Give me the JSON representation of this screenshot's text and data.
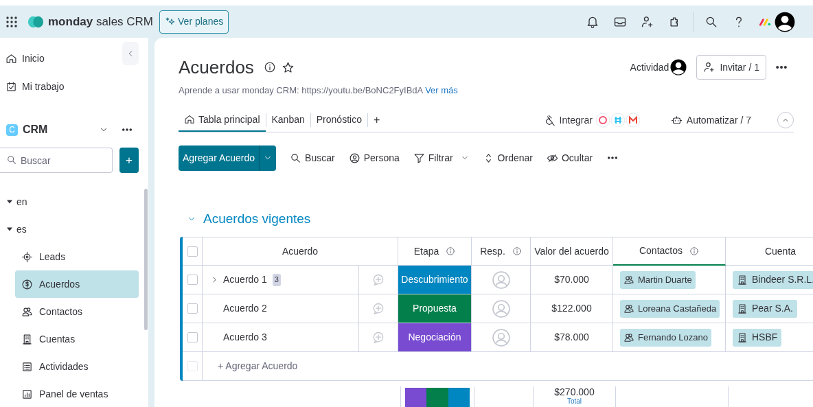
{
  "topbar": {
    "logo_bold": "monday",
    "logo_rest": "sales CRM",
    "plans_button": "Ver planes"
  },
  "sidebar": {
    "nav": [
      {
        "label": "Inicio"
      },
      {
        "label": "Mi trabajo"
      }
    ],
    "workspace": {
      "badge": "C",
      "name": "CRM"
    },
    "search": {
      "placeholder": "Buscar"
    },
    "add_button": "+",
    "tree": [
      {
        "label": "en",
        "expanded": true
      },
      {
        "label": "es",
        "expanded": true,
        "children": [
          {
            "label": "Leads",
            "selected": false
          },
          {
            "label": "Acuerdos",
            "selected": true
          },
          {
            "label": "Contactos",
            "selected": false
          },
          {
            "label": "Cuentas",
            "selected": false
          },
          {
            "label": "Actividades",
            "selected": false
          },
          {
            "label": "Panel de ventas",
            "selected": false
          }
        ]
      }
    ]
  },
  "board": {
    "title": "Acuerdos",
    "description": "Aprende a usar monday CRM: https://youtu.be/BoNC2FyIBdA",
    "more_link": "Ver más",
    "activity": "Actividad",
    "invite": "Invitar / 1",
    "views": [
      {
        "label": "Tabla principal",
        "selected": true
      },
      {
        "label": "Kanban",
        "selected": false
      },
      {
        "label": "Pronóstico",
        "selected": false
      }
    ],
    "add_view": "+",
    "integrate": "Integrar",
    "automate": "Automatizar / 7",
    "primary_button": "Agregar Acuerdo",
    "tools": [
      "Buscar",
      "Persona",
      "Filtrar",
      "Ordenar",
      "Ocultar"
    ]
  },
  "group": {
    "title": "Acuerdos vigentes",
    "color": "#0086c0",
    "all_checked": false,
    "columns": [
      {
        "label": "Acuerdo",
        "info": false
      },
      {
        "label": "Etapa",
        "info": true
      },
      {
        "label": "Resp.",
        "info": true
      },
      {
        "label": "Valor del acuerdo",
        "info": false
      },
      {
        "label": "Contactos",
        "info": true
      },
      {
        "label": "Cuenta",
        "info": false
      }
    ],
    "rows": [
      {
        "name": "Acuerdo 1",
        "checked": false,
        "subitems": "3",
        "stage": {
          "label": "Descubrimiento",
          "color": "#0086c0"
        },
        "value": "$70.000",
        "contact": "Martin Duarte",
        "account": "Bindeer S.R.L."
      },
      {
        "name": "Acuerdo 2",
        "checked": false,
        "stage": {
          "label": "Propuesta",
          "color": "#037f4c"
        },
        "value": "$122.000",
        "contact": "Loreana Castañeda",
        "account": "Pear S.A."
      },
      {
        "name": "Acuerdo 3",
        "checked": false,
        "stage": {
          "label": "Negociación",
          "color": "#784bd1"
        },
        "value": "$78.000",
        "contact": "Fernando Lozano",
        "account": "HSBF"
      }
    ],
    "add_row": {
      "label": "+ Agregar Acuerdo",
      "checked": false
    },
    "total": "$270.000",
    "total_label": "Total"
  }
}
